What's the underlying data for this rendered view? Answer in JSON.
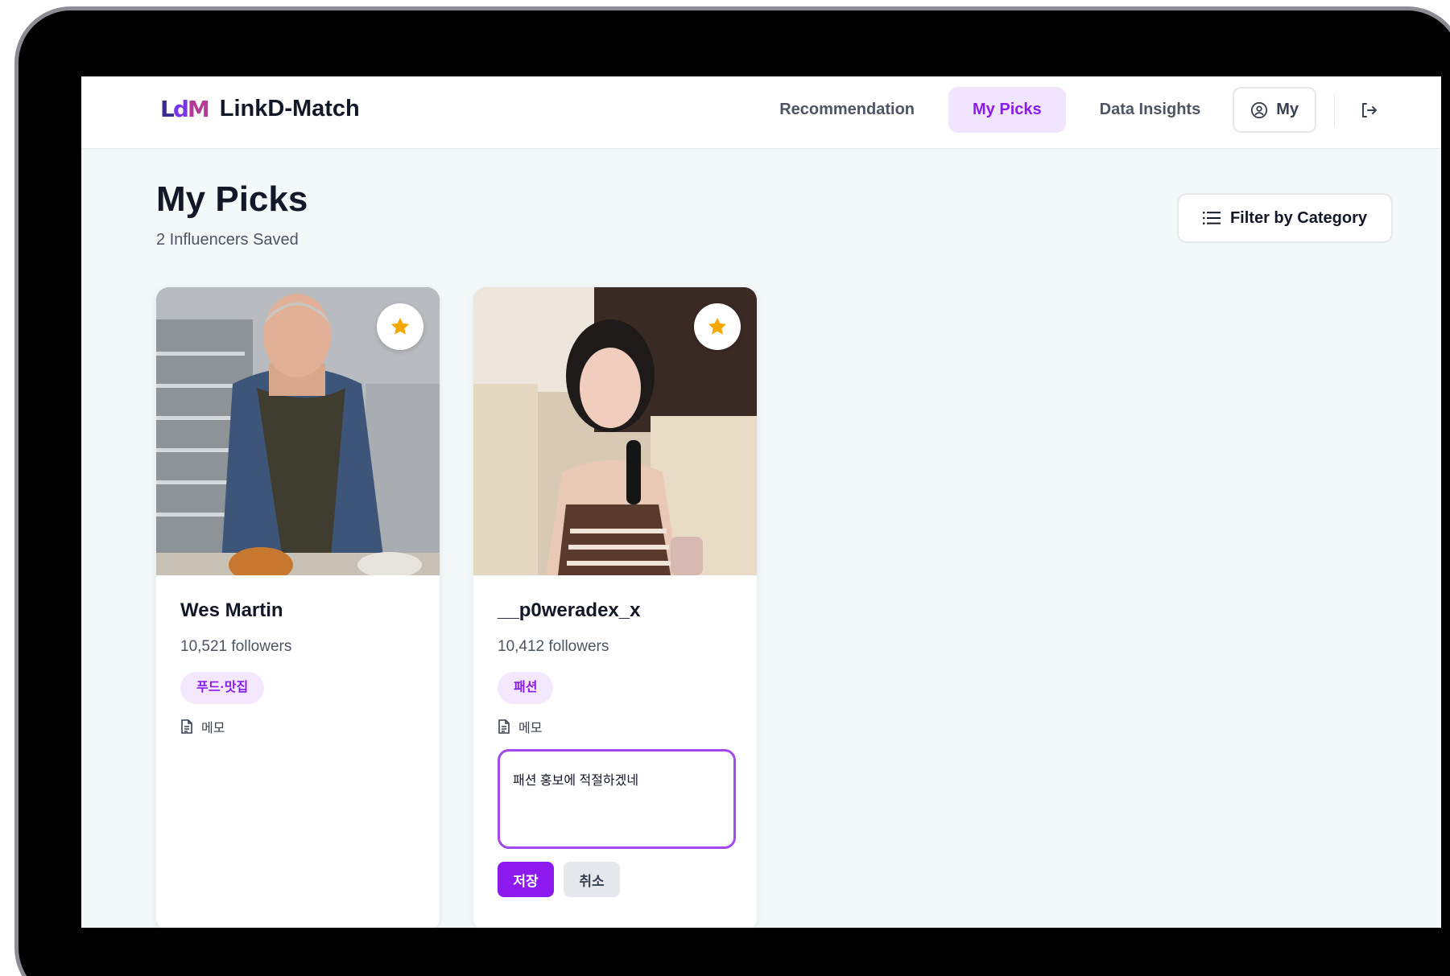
{
  "app": {
    "logo_mark_l": "L",
    "logo_mark_d": "d",
    "logo_mark_m": "M",
    "name": "LinkD-Match"
  },
  "nav": {
    "items": [
      {
        "label": "Recommendation",
        "active": false
      },
      {
        "label": "My Picks",
        "active": true
      },
      {
        "label": "Data Insights",
        "active": false
      }
    ],
    "my_label": "My",
    "logout_icon": "logout-icon"
  },
  "page": {
    "title": "My Picks",
    "subtitle": "2 Influencers Saved",
    "filter_label": "Filter by Category"
  },
  "cards": [
    {
      "name": "Wes Martin",
      "followers": "10,521 followers",
      "tag": "푸드·맛집",
      "memo_label": "메모",
      "starred": true
    },
    {
      "name": "__p0weradex_x",
      "followers": "10,412 followers",
      "tag": "패션",
      "memo_label": "메모",
      "memo_value": "패션 홍보에 적절하겠네",
      "save_label": "저장",
      "cancel_label": "취소",
      "starred": true
    }
  ],
  "colors": {
    "accent": "#8c19ee",
    "accent_soft": "#f3e8ff",
    "star": "#f5a800",
    "bg": "#f3f8f9"
  }
}
